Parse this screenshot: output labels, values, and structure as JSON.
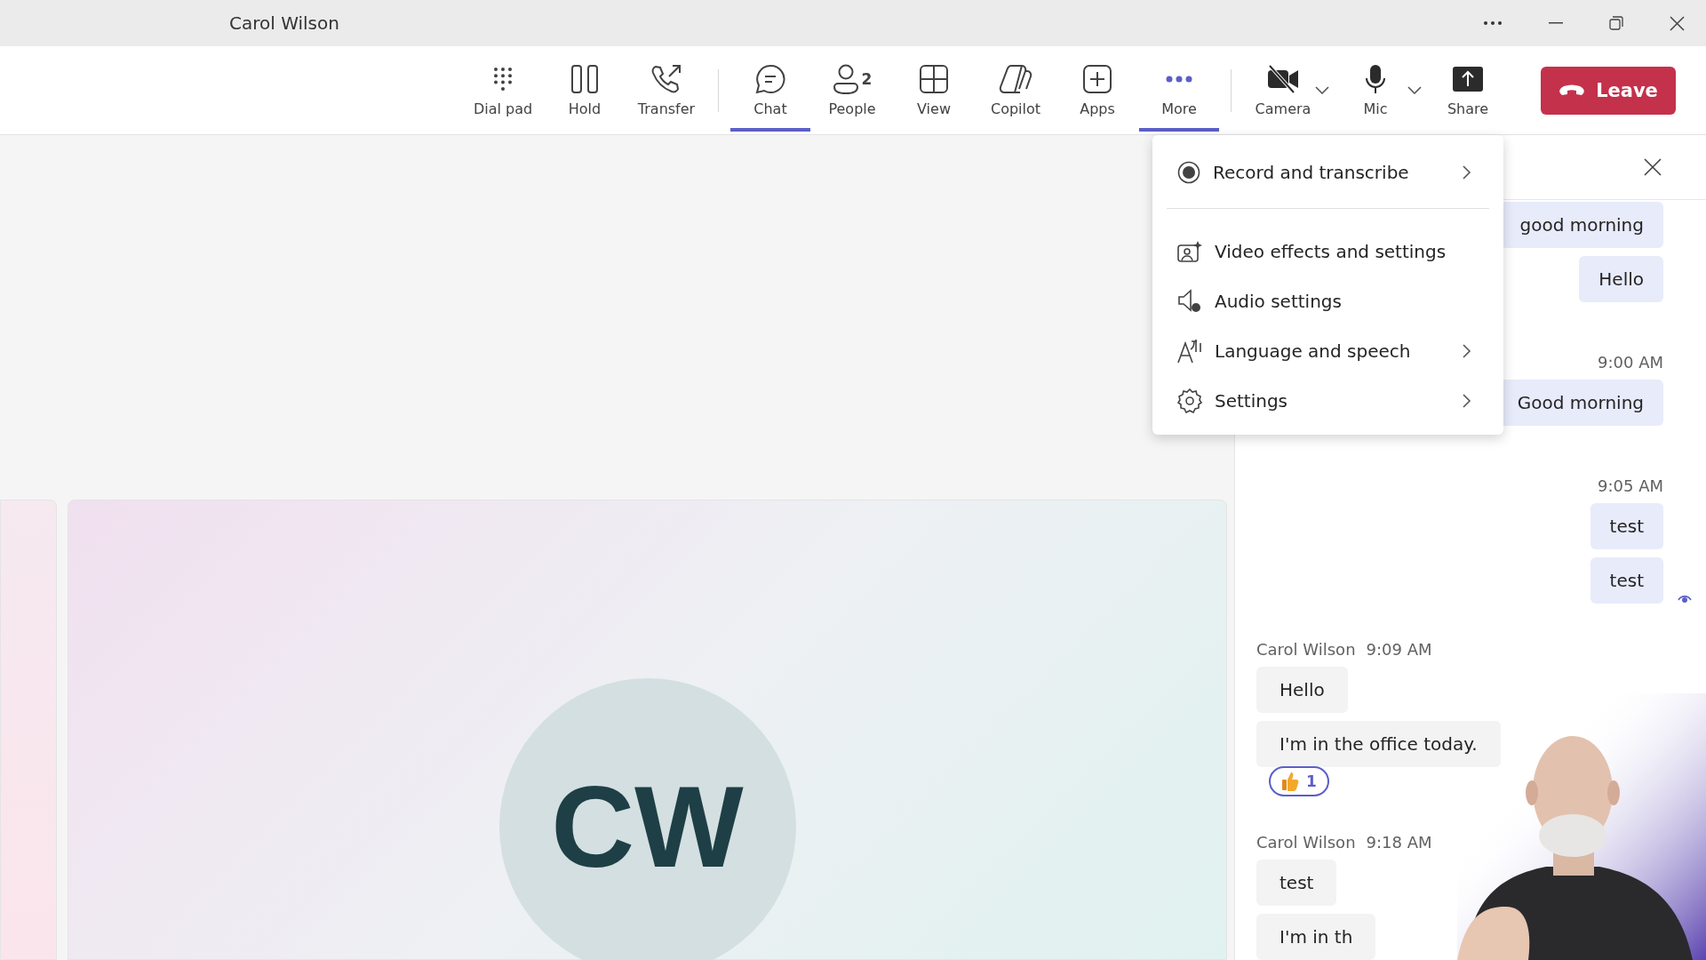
{
  "window": {
    "title": "Carol Wilson"
  },
  "toolbar": {
    "groups": [
      [
        {
          "label": "Dial pad",
          "selected": false
        },
        {
          "label": "Hold",
          "selected": false
        },
        {
          "label": "Transfer",
          "selected": false
        }
      ],
      [
        {
          "label": "Chat",
          "selected": true
        },
        {
          "label": "People",
          "selected": false,
          "badge": "2"
        },
        {
          "label": "View",
          "selected": false
        },
        {
          "label": "Copilot",
          "selected": false
        },
        {
          "label": "Apps",
          "selected": false
        },
        {
          "label": "More",
          "selected": true
        }
      ],
      [
        {
          "label": "Camera",
          "selected": false,
          "on": false,
          "dropdown": true
        },
        {
          "label": "Mic",
          "selected": false,
          "on": true,
          "dropdown": true
        },
        {
          "label": "Share",
          "selected": false
        }
      ]
    ],
    "leave_button": {
      "label": "Leave"
    }
  },
  "more_menu": {
    "sections": [
      [
        {
          "label": "Record and transcribe",
          "submenu": true
        }
      ],
      [
        {
          "label": "Video effects and settings",
          "submenu": false
        },
        {
          "label": "Audio settings",
          "submenu": false
        },
        {
          "label": "Language and speech",
          "submenu": true
        },
        {
          "label": "Settings",
          "submenu": true
        }
      ]
    ]
  },
  "stage": {
    "avatar_initials": "CW"
  },
  "chat": {
    "messages": [
      {
        "kind": "sent",
        "text": "good morning",
        "seen": false
      },
      {
        "kind": "sent",
        "text": "Hello",
        "seen": false
      },
      {
        "kind": "time",
        "text": "9:00 AM"
      },
      {
        "kind": "sent",
        "text": "Good morning",
        "seen": false
      },
      {
        "kind": "time",
        "text": "9:05 AM"
      },
      {
        "kind": "sent",
        "text": "test",
        "seen": false
      },
      {
        "kind": "sent",
        "text": "test",
        "seen": true
      },
      {
        "kind": "header",
        "sender": "Carol Wilson",
        "time": "9:09 AM"
      },
      {
        "kind": "received",
        "text": "Hello"
      },
      {
        "kind": "received",
        "text": "I'm in the office today.",
        "reaction": {
          "count": "1"
        }
      },
      {
        "kind": "header",
        "sender": "Carol Wilson",
        "time": "9:18 AM"
      },
      {
        "kind": "received",
        "text": "test"
      },
      {
        "kind": "received",
        "text": "I'm in th"
      }
    ]
  }
}
